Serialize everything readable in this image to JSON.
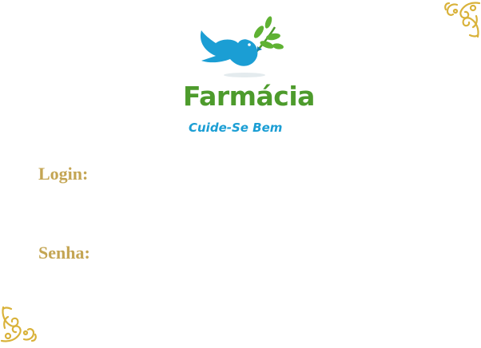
{
  "brand": {
    "name": "Farmácia",
    "tagline": "Cuide-Se Bem",
    "logo_icon": "dove-with-olive-branch-icon",
    "colors": {
      "name": "#4d9b2c",
      "tagline": "#1b9ed4",
      "dove": "#1b9ed4",
      "leaves": "#5fb233"
    }
  },
  "form": {
    "login_label": "Login:",
    "login_value": "",
    "senha_label": "Senha:",
    "senha_value": "",
    "label_color": "#c4a553"
  },
  "decorations": {
    "corner_icon": "gold-floral-ornament-icon",
    "color": "#d9b23a"
  }
}
